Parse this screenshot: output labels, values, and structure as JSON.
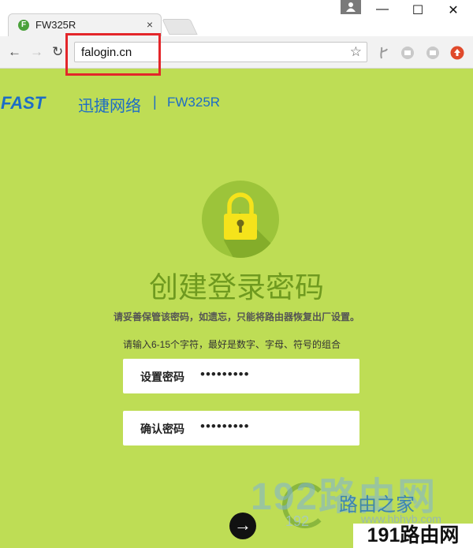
{
  "browser": {
    "tab_title": "FW325R",
    "tab_favicon_letter": "F",
    "tab_close": "×",
    "address": "falogin.cn",
    "window_minimize": "—",
    "window_maximize": "☐",
    "window_close": "✕",
    "back": "←",
    "forward": "→",
    "reload": "↻",
    "bookmark_star": "☆",
    "highlight_color": "#e3262a"
  },
  "header": {
    "logo": "FAST",
    "brand_cn": "迅捷网络",
    "separator": "|",
    "model": "FW325R"
  },
  "main": {
    "heading": "创建登录密码",
    "tip_forget": "请妥善保管该密码，如遗忘，只能将路由器恢复出厂设置。",
    "tip_rule": "请输入6-15个字符，最好是数字、字母、符号的组合",
    "password_label": "设置密码",
    "password_value": "•••••••••",
    "confirm_label": "确认密码",
    "confirm_value": "•••••••••",
    "next_icon": "→"
  },
  "watermark": {
    "big": "192路由网",
    "home": "路由之家",
    "url": "www.hbhyb.com",
    "site_prefix": "192",
    "corner": "191路由网"
  },
  "colors": {
    "page_bg": "#bedd55",
    "brand_blue": "#1d6cc6",
    "heading_green": "#6f9a1f",
    "lock_circle": "#9cc43a",
    "lock_yellow": "#f5e31b"
  },
  "icons": [
    "favicon-icon",
    "close-icon",
    "user-icon",
    "back-icon",
    "forward-icon",
    "reload-icon",
    "star-icon",
    "extension-icon",
    "lock-icon",
    "arrow-right-icon"
  ]
}
